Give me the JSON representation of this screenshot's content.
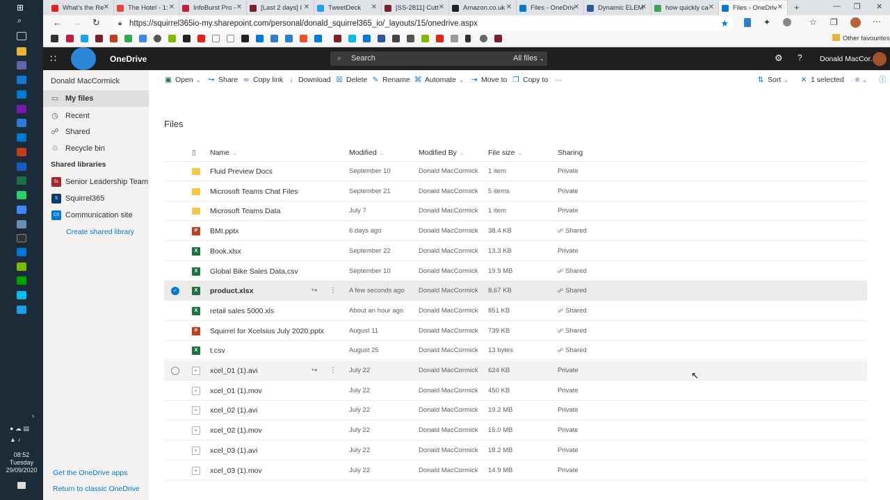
{
  "taskbar": {
    "time": "08:52",
    "day": "Tuesday",
    "date": "29/09/2020"
  },
  "browser": {
    "tabs": [
      {
        "label": "What's the Re",
        "color": "#e62117"
      },
      {
        "label": "The Hotel - 1:",
        "color": "#e8453c"
      },
      {
        "label": "InfoBurst Pro -",
        "color": "#c41e3a"
      },
      {
        "label": "[Last 2 days] I",
        "color": "#7a1f2b"
      },
      {
        "label": "TweetDeck",
        "color": "#1da1f2"
      },
      {
        "label": "[SS-2811] Cutt",
        "color": "#7a1f2b"
      },
      {
        "label": "Amazon.co.uk",
        "color": "#222222"
      },
      {
        "label": "Files - OneDriv",
        "color": "#0078d4"
      },
      {
        "label": "Dynamic ELEM",
        "color": "#2b579a"
      },
      {
        "label": "how quickly ca",
        "color": "#34a853"
      },
      {
        "label": "Files - OneDriv",
        "color": "#0078d4"
      }
    ],
    "url": "https://squirrel365io-my.sharepoint.com/personal/donald_squirrel365_io/_layouts/15/onedrive.aspx",
    "other_favourites": "Other favourites"
  },
  "header": {
    "app_name": "OneDrive",
    "search_placeholder": "Search",
    "search_scope": "All files",
    "user_name": "Donald MacCor..."
  },
  "sidebar": {
    "owner": "Donald MacCormick",
    "items": [
      {
        "label": "My files",
        "icon": "folder-icon"
      },
      {
        "label": "Recent",
        "icon": "clock-icon"
      },
      {
        "label": "Shared",
        "icon": "people-icon"
      },
      {
        "label": "Recycle bin",
        "icon": "recycle-bin-icon"
      }
    ],
    "shared_libraries_heading": "Shared libraries",
    "libraries": [
      {
        "label": "Senior Leadership Team",
        "initials": "SL",
        "color": "#a4262c"
      },
      {
        "label": "Squirrel365",
        "initials": "S",
        "color": "#0b3a73"
      },
      {
        "label": "Communication site",
        "initials": "CS",
        "color": "#0078d4"
      }
    ],
    "create_library": "Create shared library",
    "get_apps": "Get the OneDrive apps",
    "return_classic": "Return to classic OneDrive"
  },
  "commands": {
    "open": "Open",
    "share": "Share",
    "copy_link": "Copy link",
    "download": "Download",
    "delete": "Delete",
    "rename": "Rename",
    "automate": "Automate",
    "move_to": "Move to",
    "copy_to": "Copy to",
    "more": "···",
    "sort": "Sort",
    "selected": "1 selected"
  },
  "files": {
    "title": "Files",
    "columns": {
      "name": "Name",
      "modified": "Modified",
      "modified_by": "Modified By",
      "file_size": "File size",
      "sharing": "Sharing"
    },
    "rows": [
      {
        "name": "Fluid Preview Docs",
        "type": "folder",
        "modified": "September 10",
        "by": "Donald MacCormick",
        "size": "1 item",
        "sharing": "Private"
      },
      {
        "name": "Microsoft Teams Chat Files",
        "type": "folder",
        "modified": "September 21",
        "by": "Donald MacCormick",
        "size": "5 items",
        "sharing": "Private"
      },
      {
        "name": "Microsoft Teams Data",
        "type": "folder",
        "modified": "July 7",
        "by": "Donald MacCormick",
        "size": "1 item",
        "sharing": "Private"
      },
      {
        "name": "BMI.pptx",
        "type": "pptx",
        "modified": "6 days ago",
        "by": "Donald MacCormick",
        "size": "38.4 KB",
        "sharing": "Shared"
      },
      {
        "name": "Book.xlsx",
        "type": "xlsx",
        "modified": "September 22",
        "by": "Donald MacCormick",
        "size": "13.3 KB",
        "sharing": "Private"
      },
      {
        "name": "Global Bike Sales Data.csv",
        "type": "csv",
        "modified": "September 10",
        "by": "Donald MacCormick",
        "size": "19.9 MB",
        "sharing": "Shared"
      },
      {
        "name": "product.xlsx",
        "type": "xlsx",
        "modified": "A few seconds ago",
        "by": "Donald MacCormick",
        "size": "8.67 KB",
        "sharing": "Shared",
        "state": "selected"
      },
      {
        "name": "retail sales 5000.xls",
        "type": "xlsx",
        "modified": "About an hour ago",
        "by": "Donald MacCormick",
        "size": "851 KB",
        "sharing": "Shared"
      },
      {
        "name": "Squirrel for Xcelsius July 2020.pptx",
        "type": "pptx",
        "modified": "August 11",
        "by": "Donald MacCormick",
        "size": "739 KB",
        "sharing": "Shared"
      },
      {
        "name": "t.csv",
        "type": "csv",
        "modified": "August 25",
        "by": "Donald MacCormick",
        "size": "13 bytes",
        "sharing": "Shared"
      },
      {
        "name": "xcel_01 (1).avi",
        "type": "media",
        "modified": "July 22",
        "by": "Donald MacCormick",
        "size": "624 KB",
        "sharing": "Private",
        "state": "hover"
      },
      {
        "name": "xcel_01 (1).mov",
        "type": "media",
        "modified": "July 22",
        "by": "Donald MacCormick",
        "size": "450 KB",
        "sharing": "Private"
      },
      {
        "name": "xcel_02 (1).avi",
        "type": "media",
        "modified": "July 22",
        "by": "Donald MacCormick",
        "size": "19.2 MB",
        "sharing": "Private"
      },
      {
        "name": "xcel_02 (1).mov",
        "type": "media",
        "modified": "July 22",
        "by": "Donald MacCormick",
        "size": "15.0 MB",
        "sharing": "Private"
      },
      {
        "name": "xcel_03 (1).avi",
        "type": "media",
        "modified": "July 22",
        "by": "Donald MacCormick",
        "size": "18.2 MB",
        "sharing": "Private"
      },
      {
        "name": "xcel_03 (1).mov",
        "type": "media",
        "modified": "July 22",
        "by": "Donald MacCormick",
        "size": "14.9 MB",
        "sharing": "Private"
      }
    ]
  },
  "colors": {
    "accent": "#0078d4",
    "header_bg": "#1f1f1f",
    "sidebar_bg": "#f3f2f1"
  }
}
